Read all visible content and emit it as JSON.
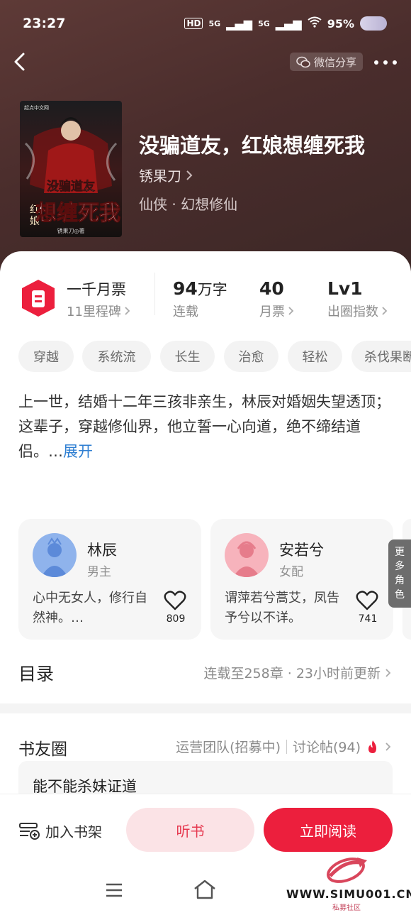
{
  "status_bar": {
    "time": "23:27",
    "battery": "95%",
    "net1": "5G",
    "net2": "5G",
    "hd": "HD"
  },
  "header": {
    "share_label": "微信分享"
  },
  "book": {
    "title": "没骗道友，红娘想缠死我",
    "author": "锈果刀",
    "genre": "仙侠 · 幻想修仙",
    "cover_text": "没骗道友 红娘 想缠死我",
    "cover_publisher": "起点中文网",
    "cover_author": "锈果刀◎著"
  },
  "stats": {
    "ticket_title": "一千月票",
    "ticket_sub": "11里程碑",
    "words_num": "94",
    "words_unit": "万字",
    "words_sub": "连载",
    "monthly_num": "40",
    "monthly_sub": "月票",
    "level_num": "Lv1",
    "level_sub": "出圈指数"
  },
  "tags": [
    "穿越",
    "系统流",
    "长生",
    "治愈",
    "轻松",
    "杀伐果断"
  ],
  "description": {
    "text": "上一世，结婚十二年三孩非亲生，林辰对婚姻失望透顶；\n这辈子，穿越修仙界，他立誓一心向道，绝不缔结道侣。…",
    "expand": "展开"
  },
  "characters": [
    {
      "name": "林辰",
      "role": "男主",
      "desc": "心中无女人，修行自然神。…",
      "likes": "809"
    },
    {
      "name": "安若兮",
      "role": "女配",
      "desc": "谓萍若兮蒿艾，凤告予兮以不详。",
      "likes": "741"
    }
  ],
  "more_roles": "更多角色",
  "toc": {
    "title": "目录",
    "info": "连载至258章 · 23小时前更新"
  },
  "club": {
    "title": "书友圈",
    "team": "运营团队(招募中)",
    "posts": "讨论帖(94)",
    "post_preview": "能不能杀妹证道"
  },
  "actions": {
    "add_shelf": "加入书架",
    "listen": "听书",
    "read": "立即阅读"
  },
  "watermark": {
    "site": "WWW.SIMU001.CN",
    "sub": "私募社区"
  },
  "colors": {
    "accent": "#ec1f3d",
    "hero_bg": "#4a2d2c",
    "link": "#2f7fd2"
  }
}
